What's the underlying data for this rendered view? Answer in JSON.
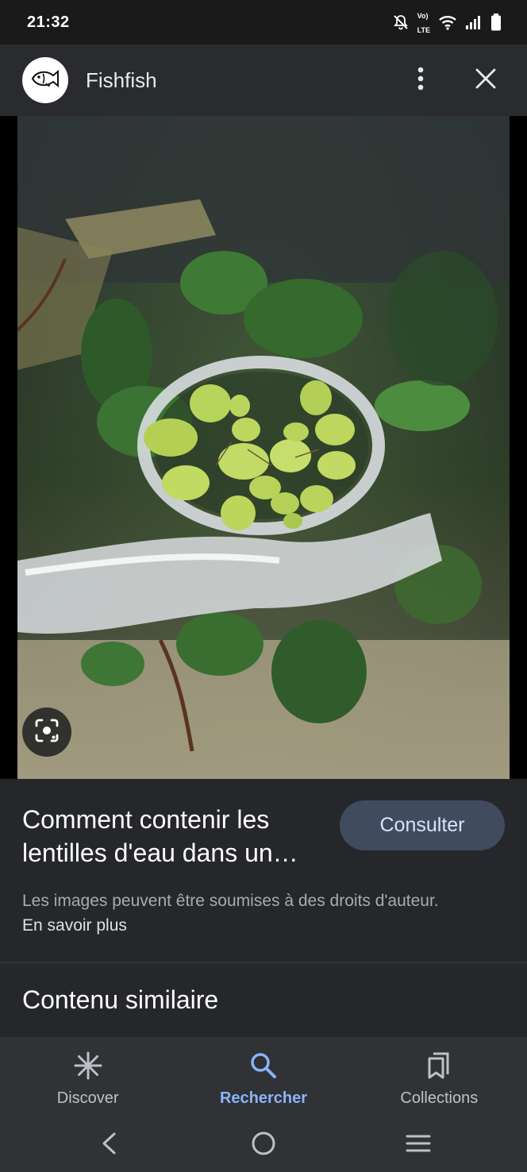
{
  "status": {
    "time": "21:32",
    "network_label": "LTE"
  },
  "header": {
    "site_name": "Fishfish",
    "avatar_icon": "fish-icon"
  },
  "result": {
    "title": "Comment contenir les lentilles d'eau dans un…",
    "visit_label": "Consulter",
    "copyright_text": "Les images peuvent être soumises à des droits d'auteur. ",
    "learn_more_label": "En savoir plus"
  },
  "similar": {
    "title": "Contenu similaire"
  },
  "bottom_nav": [
    {
      "label": "Discover",
      "icon": "asterisk-icon",
      "active": false
    },
    {
      "label": "Rechercher",
      "icon": "search-icon",
      "active": true
    },
    {
      "label": "Collections",
      "icon": "collections-icon",
      "active": false
    }
  ],
  "colors": {
    "accent": "#8ab4f8",
    "button_bg": "#414b5e",
    "surface": "#25272b"
  }
}
